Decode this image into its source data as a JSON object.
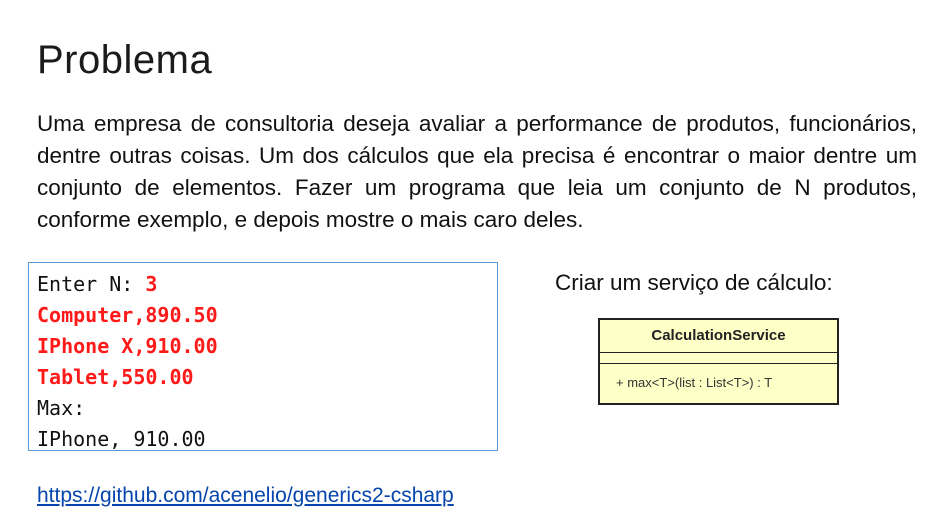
{
  "slide": {
    "title": "Problema",
    "paragraph": "Uma empresa de consultoria deseja avaliar a performance de produtos, funcionários, dentre outras coisas. Um dos cálculos que ela precisa é encontrar o maior dentre um conjunto de elementos. Fazer um programa que leia um conjunto de N produtos, conforme exemplo, e depois mostre o mais caro deles."
  },
  "console": {
    "prompt_label": "Enter N: ",
    "prompt_value": "3",
    "inputs": [
      "Computer,890.50",
      "IPhone X,910.00",
      "Tablet,550.00"
    ],
    "output_label": "Max:",
    "output_value": "IPhone, 910.00"
  },
  "service": {
    "caption": "Criar um serviço de cálculo:",
    "class_name": "CalculationService",
    "operation": "+ max<T>(list : List<T>) : T"
  },
  "link": {
    "text": "https://github.com/acenelio/generics2-csharp"
  },
  "colors": {
    "input_highlight": "#ff1a1a",
    "console_border": "#5b9bd5",
    "uml_fill": "#ffffc8",
    "link": "#0645ad"
  }
}
